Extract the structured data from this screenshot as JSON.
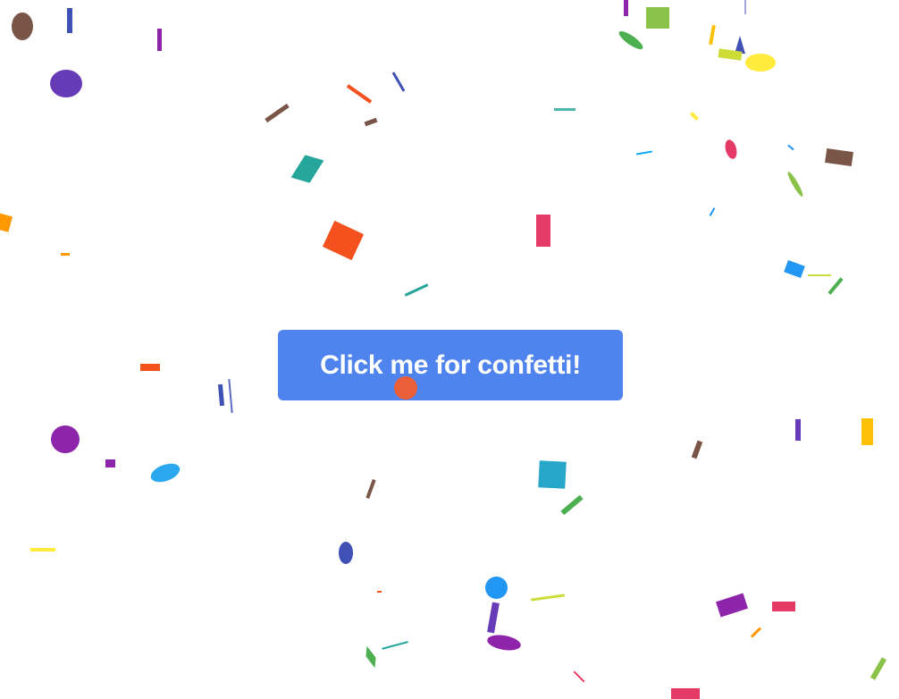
{
  "button": {
    "label": "Click me for confetti!",
    "color": "#4f84ee",
    "text_color": "#ffffff"
  },
  "cursor": {
    "color": "#ea5f38"
  },
  "confetti_palette": [
    "#e53966",
    "#3f51b5",
    "#8e24aa",
    "#4caf50",
    "#ff9800",
    "#03a9f4",
    "#795548",
    "#ffeb3b",
    "#8bc34a",
    "#f4511e",
    "#2196f3",
    "#e91e63",
    "#ffc107",
    "#673ab7",
    "#26a69a"
  ]
}
